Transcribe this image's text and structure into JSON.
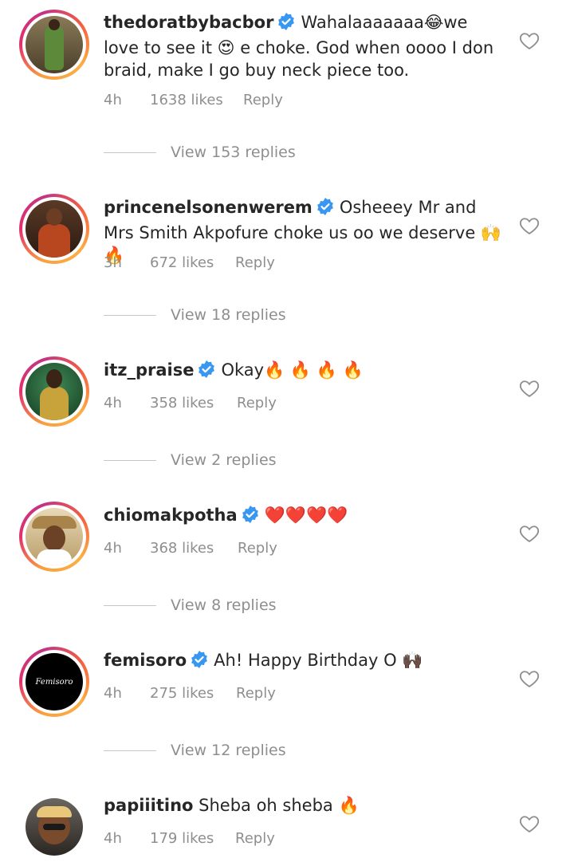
{
  "comments": [
    {
      "username": "thedoratbybacbor",
      "text": "Wahalaaaaaaa😂we love to see it 😍 e choke. God when oooo I don braid, make I go buy neck piece too.",
      "time": "4h",
      "likes": "1638 likes",
      "reply": "Reply",
      "view_replies": "View 153 replies",
      "verified": true,
      "avatar_color": "#6b5a3c"
    },
    {
      "username": "princenelsonenwerem",
      "text": "Osheeey Mr and Mrs Smith Akpofure choke us oo we deserve 🙌🔥",
      "time": "3h",
      "likes": "672 likes",
      "reply": "Reply",
      "view_replies": "View 18 replies",
      "verified": true,
      "avatar_color": "#7a3a1e"
    },
    {
      "username": "itz_praise",
      "text": "Okay🔥 🔥 🔥 🔥",
      "time": "4h",
      "likes": "358 likes",
      "reply": "Reply",
      "view_replies": "View 2 replies",
      "verified": true,
      "avatar_color": "#1f5a33"
    },
    {
      "username": "chiomakpotha",
      "text": "❤️❤️❤️❤️",
      "time": "4h",
      "likes": "368 likes",
      "reply": "Reply",
      "view_replies": "View 8 replies",
      "verified": true,
      "avatar_color": "#c9b27a"
    },
    {
      "username": "femisoro",
      "text": "Ah! Happy Birthday O 🙌🏿",
      "time": "4h",
      "likes": "275 likes",
      "reply": "Reply",
      "view_replies": "View 12 replies",
      "verified": true,
      "avatar_color": "#000000",
      "avatar_logo": "Femisoro"
    },
    {
      "username": "papiiitino",
      "text": "Sheba oh sheba 🔥",
      "time": "4h",
      "likes": "179 likes",
      "reply": "Reply",
      "verified": false,
      "avatar_color": "#3a3530"
    }
  ],
  "icons": {
    "verified": "verified-badge-icon",
    "like": "heart-outline-icon"
  },
  "colors": {
    "verified_blue": "#3897f0",
    "meta_gray": "#8e8e8e",
    "text": "#262626"
  }
}
